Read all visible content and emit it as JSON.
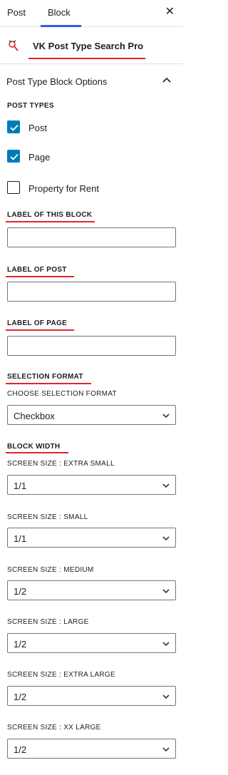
{
  "tabs": {
    "post": "Post",
    "block": "Block"
  },
  "close_icon": "close-icon",
  "block_card": {
    "icon": "block-icon",
    "title": "VK Post Type Search Pro"
  },
  "panel": {
    "title": "Post Type Block Options",
    "toggle_icon": "chevron-up-icon"
  },
  "post_types": {
    "label": "POST TYPES",
    "items": [
      {
        "label": "Post",
        "checked": true
      },
      {
        "label": "Page",
        "checked": true
      },
      {
        "label": "Property for Rent",
        "checked": false
      }
    ]
  },
  "fields": {
    "label_of_block": {
      "label": "LABEL OF THIS BLOCK",
      "value": ""
    },
    "label_of_post": {
      "label": "LABEL OF POST",
      "value": ""
    },
    "label_of_page": {
      "label": "LABEL OF PAGE",
      "value": ""
    }
  },
  "selection_format": {
    "label": "SELECTION FORMAT",
    "sub_label": "CHOOSE SELECTION FORMAT",
    "value": "Checkbox"
  },
  "block_width": {
    "label": "BLOCK WIDTH",
    "sizes": [
      {
        "label": "SCREEN SIZE : EXTRA SMALL",
        "value": "1/1"
      },
      {
        "label": "SCREEN SIZE : SMALL",
        "value": "1/1"
      },
      {
        "label": "SCREEN SIZE : MEDIUM",
        "value": "1/2"
      },
      {
        "label": "SCREEN SIZE : LARGE",
        "value": "1/2"
      },
      {
        "label": "SCREEN SIZE : EXTRA LARGE",
        "value": "1/2"
      },
      {
        "label": "SCREEN SIZE : XX LARGE",
        "value": "1/2"
      }
    ]
  },
  "colors": {
    "accent": "#007cba",
    "tab_indicator": "#3858e9",
    "highlight": "#e3242b"
  }
}
